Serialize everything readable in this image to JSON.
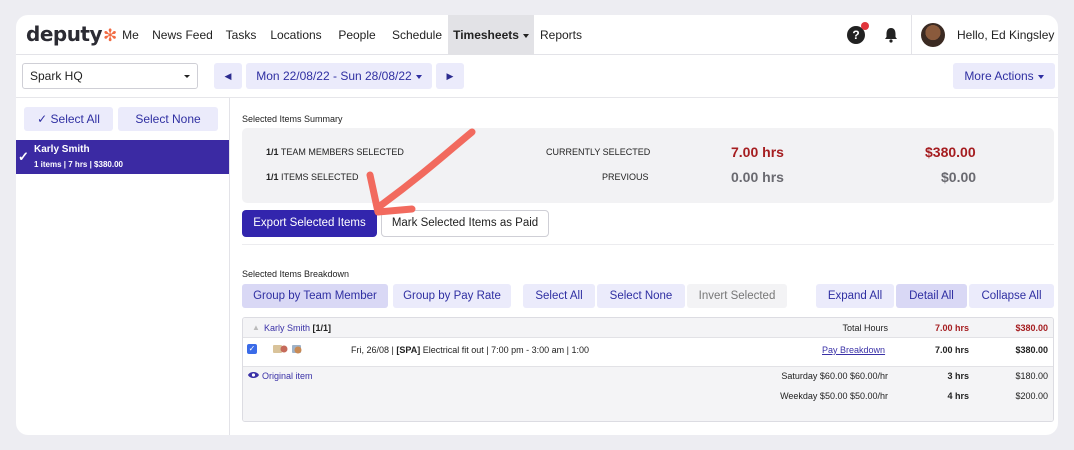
{
  "brand": {
    "name": "deputy",
    "flower": "✻"
  },
  "nav": {
    "items": [
      "Me",
      "News Feed",
      "Tasks",
      "Locations",
      "People",
      "Schedule",
      "Timesheets",
      "Reports"
    ],
    "active": "Timesheets",
    "greeting": "Hello, Ed Kingsley"
  },
  "toolbar": {
    "location": "Spark HQ",
    "week": "Mon 22/08/22 - Sun 28/08/22",
    "more_actions": "More Actions",
    "prev_glyph": "◀",
    "next_glyph": "▶"
  },
  "left": {
    "select_all": "✓ Select All",
    "select_none": "Select None",
    "member_name": "Karly Smith",
    "member_meta": "1 items | 7 hrs | $380.00"
  },
  "summary": {
    "title": "Selected Items Summary",
    "team_count": "1/1",
    "team_label": "TEAM MEMBERS SELECTED",
    "items_count": "1/1",
    "items_label": "ITEMS SELECTED",
    "current_label": "CURRENTLY SELECTED",
    "previous_label": "PREVIOUS",
    "current_hrs": "7.00 hrs",
    "current_cost": "$380.00",
    "previous_hrs": "0.00 hrs",
    "previous_cost": "$0.00"
  },
  "actions": {
    "export": "Export Selected Items",
    "mark_paid": "Mark Selected Items as Paid"
  },
  "breakdown": {
    "title": "Selected Items Breakdown",
    "group_member": "Group by Team Member",
    "group_rate": "Group by Pay Rate",
    "select_all": "Select All",
    "select_none": "Select None",
    "invert": "Invert Selected",
    "expand": "Expand All",
    "detail": "Detail All",
    "collapse": "Collapse All",
    "member": "Karly Smith",
    "member_count": "[1/1]",
    "total_label": "Total Hours",
    "total_hrs": "7.00 hrs",
    "total_cost": "$380.00",
    "shift_date": "Fri, 26/08 |",
    "shift_code": "[SPA]",
    "shift_desc": "Electrical fit out | 7:00 pm - 3:00 am | 1:00",
    "pay_link": "Pay Breakdown",
    "shift_hrs": "7.00 hrs",
    "shift_cost": "$380.00",
    "original_link": "Original item",
    "rates": [
      {
        "label": "Saturday $60.00 $60.00/hr",
        "hrs": "3 hrs",
        "cost": "$180.00"
      },
      {
        "label": "Weekday $50.00 $50.00/hr",
        "hrs": "4 hrs",
        "cost": "$200.00"
      }
    ]
  },
  "colors": {
    "primary": "#3225ad",
    "accent_light": "#ebebfb",
    "money_red": "#a51d20",
    "annotation_arrow": "#f26a5e"
  }
}
